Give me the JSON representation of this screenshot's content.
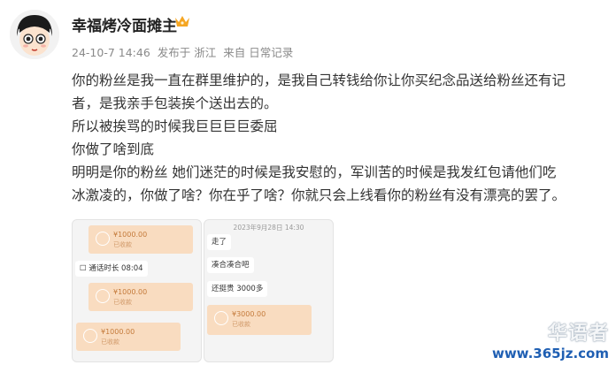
{
  "user": {
    "name": "幸福烤冷面摊主",
    "badge_icon": "crown-icon"
  },
  "meta": {
    "date": "24-10-7 14:46",
    "posted_from": "发布于 浙江",
    "source": "来自 日常记录"
  },
  "post": {
    "paragraphs": [
      "你的粉丝是我一直在群里维护的，是我自己转钱给你让你买纪念品送给粉丝还有记",
      "者，是我亲手包装挨个送出去的。",
      "所以被挨骂的时候我巨巨巨巨委屈",
      "你做了啥到底",
      "明明是你的粉丝 她们迷茫的时候是我安慰的，军训苦的时候是我发红包请他们吃",
      "冰激凌的，你做了啥？你在乎了啥？你就只会上线看你的粉丝有没有漂亮的罢了。"
    ]
  },
  "screenshot1": {
    "transfers": [
      {
        "amount": "¥1000.00",
        "note": "已收款"
      },
      {
        "amount": "¥1000.00",
        "note": "已收款"
      },
      {
        "amount": "¥1000.00",
        "note": "已收款"
      }
    ],
    "call_label": "通话时长 08:04"
  },
  "screenshot2": {
    "timestamp": "2023年9月28日 14:30",
    "messages": [
      "走了",
      "凑合凑合吧",
      "还挺贵 3000多"
    ],
    "transfer": {
      "amount": "¥3000.00",
      "note": "已收款"
    }
  },
  "watermark": {
    "text": "华语者",
    "url": "www.365jz.com"
  },
  "colors": {
    "transfer_bg": "#f9dcc0",
    "watermark_url": "#1f5fb3",
    "crown": "#f5a623"
  }
}
